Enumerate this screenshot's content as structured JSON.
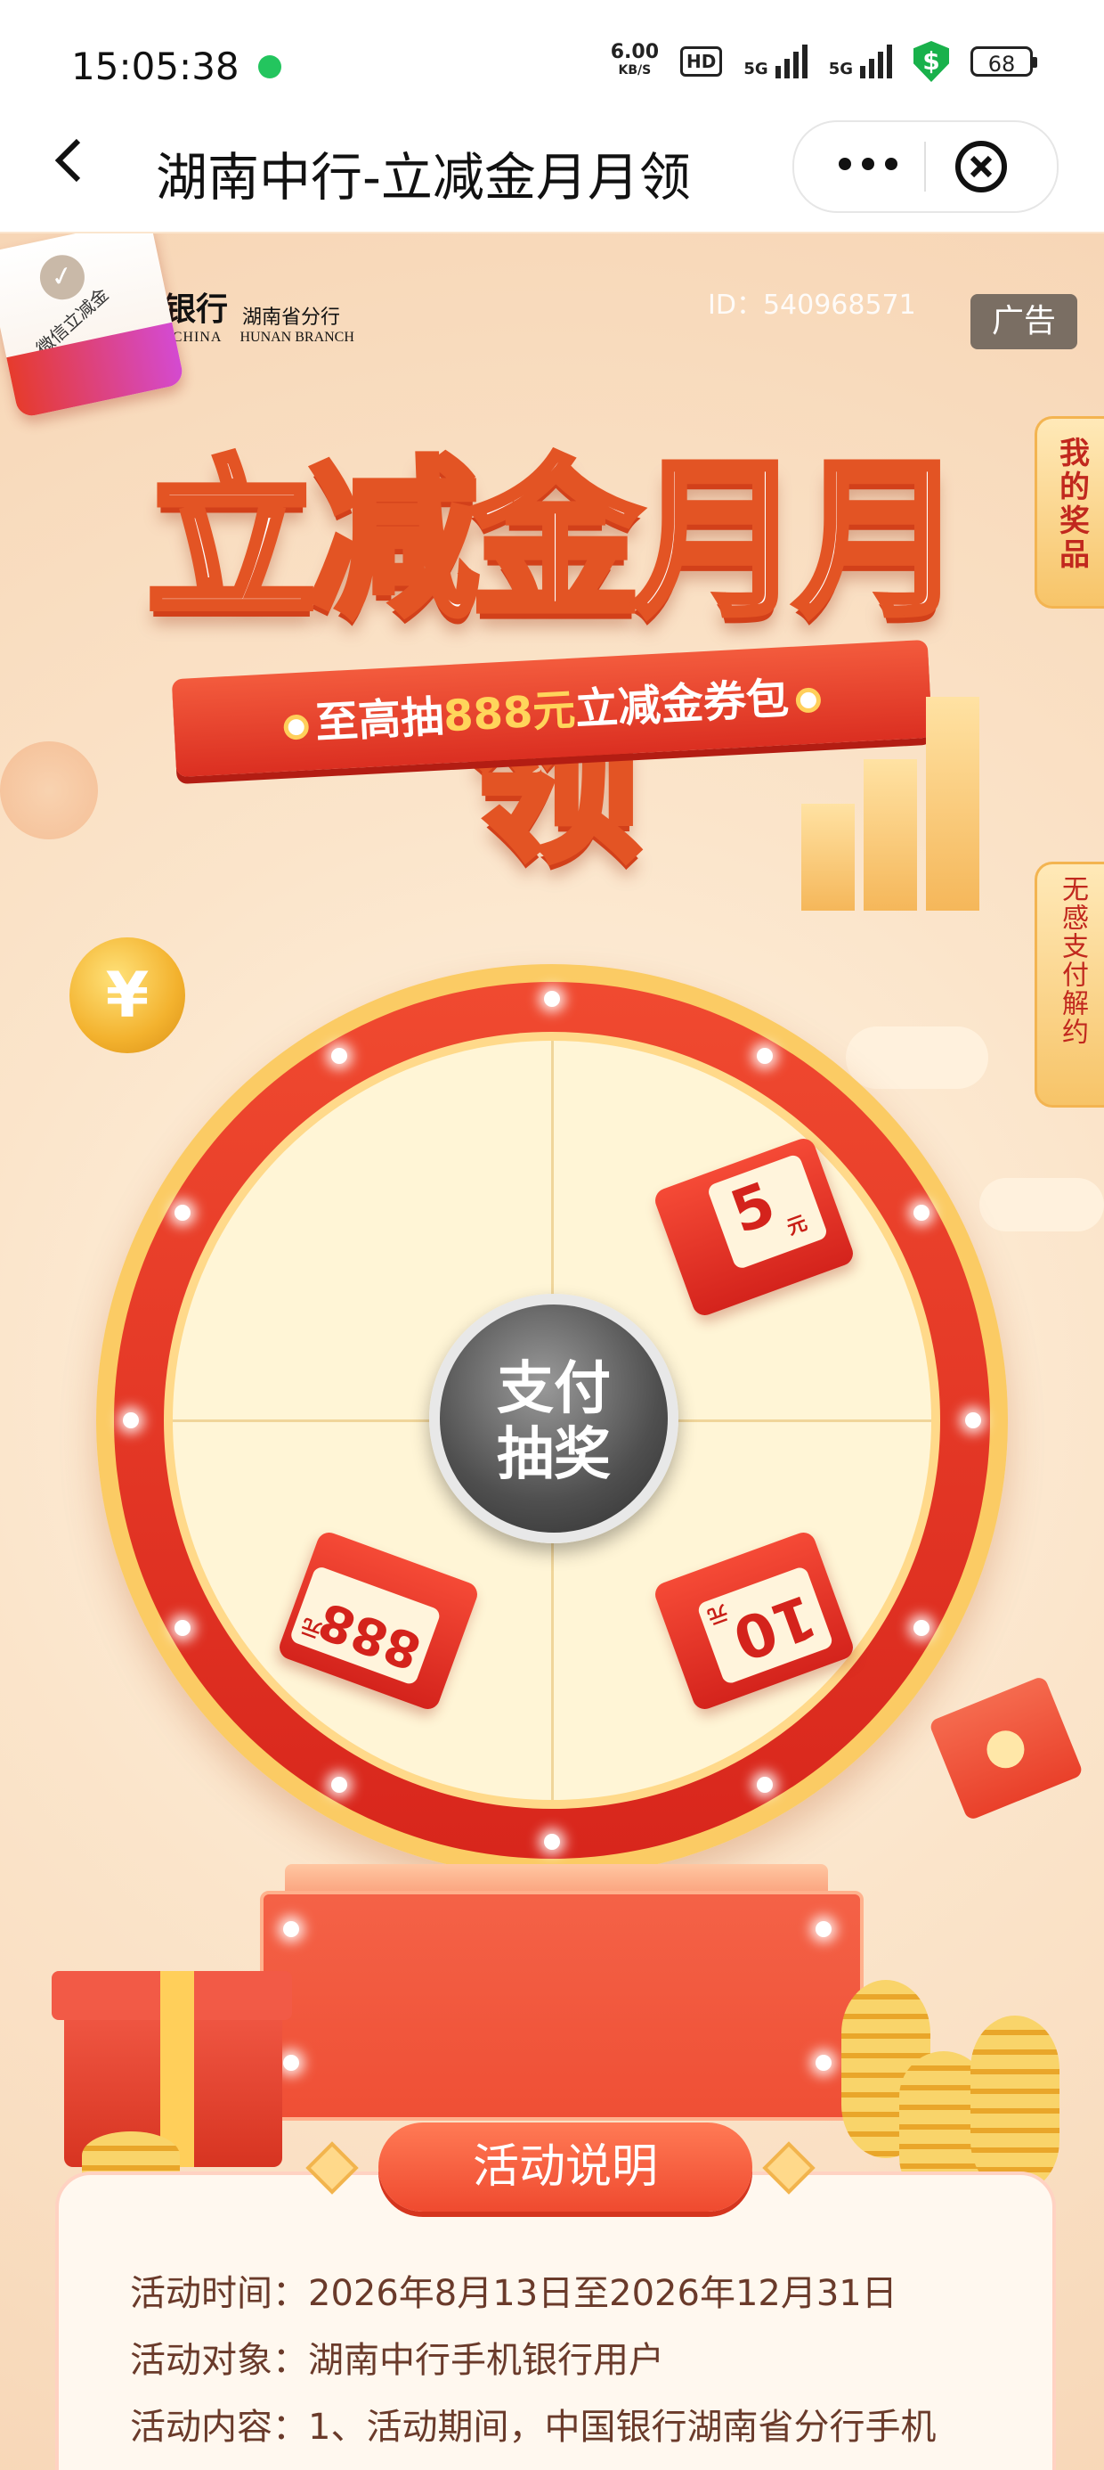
{
  "status_bar": {
    "time": "15:05:38",
    "speed_value": "6.00",
    "speed_unit": "KB/S",
    "hd": "HD",
    "net1": "5G",
    "net2": "5G",
    "battery": "68"
  },
  "nav": {
    "title": "湖南中行-立减金月月领"
  },
  "brand": {
    "name_cn": "中国银行",
    "name_en": "BANK OF CHINA",
    "branch_cn": "湖南省分行",
    "branch_en": "HUNAN BRANCH"
  },
  "meta": {
    "id_text": "ID：540968571",
    "ad_label": "广告"
  },
  "side_tabs": {
    "my_prizes": "我的奖品",
    "unbind": "无感支付解约"
  },
  "hero": {
    "headline": "立减金月月领",
    "ribbon_prefix": "至高抽",
    "ribbon_amount": "888元",
    "ribbon_suffix": "立减金券包"
  },
  "wheel": {
    "center_line1": "支付",
    "center_line2": "抽奖",
    "prizes": [
      {
        "label": "微信立减金"
      },
      {
        "value": "5",
        "unit": "元"
      },
      {
        "value": "888",
        "unit": "元"
      },
      {
        "value": "10",
        "unit": "元"
      }
    ]
  },
  "rules": {
    "title": "活动说明",
    "lines": [
      "活动时间：2026年8月13日至2026年12月31日",
      "活动对象：湖南中行手机银行用户",
      "活动内容：1、活动期间，中国银行湖南省分行手机"
    ]
  },
  "colors": {
    "brand_red": "#b5121b",
    "wheel_red": "#e8321f",
    "gold": "#ffd98a",
    "background": "#fbe6cf"
  }
}
